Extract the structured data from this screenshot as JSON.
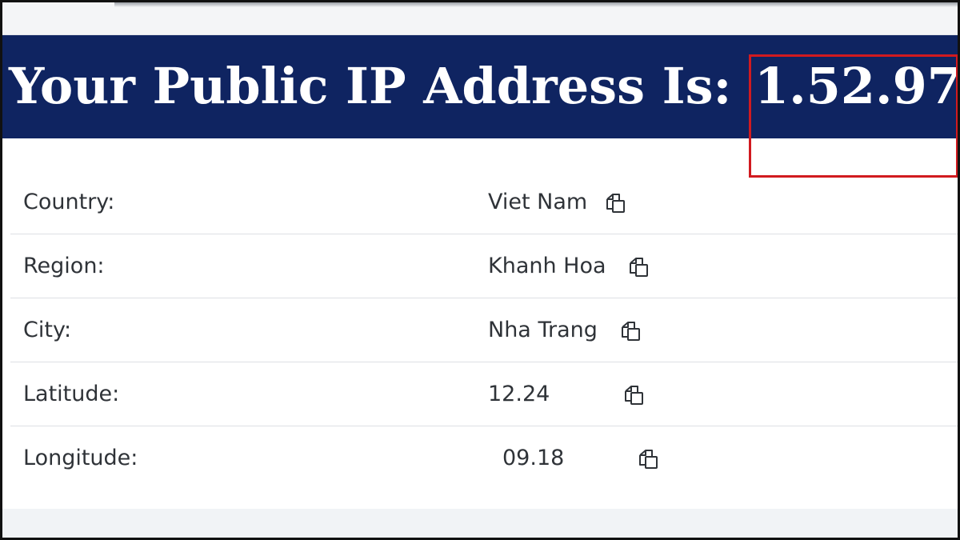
{
  "banner": {
    "title": "Your Public IP Address Is:",
    "ip": "1.52.97"
  },
  "colors": {
    "banner_bg": "#0f2461",
    "highlight": "#d11a1f",
    "text": "#2f3338"
  },
  "rows": [
    {
      "label": "Country:",
      "value": "Viet Nam",
      "icon": "copy-icon"
    },
    {
      "label": "Region:",
      "value": "Khanh Hoa",
      "icon": "copy-icon"
    },
    {
      "label": "City:",
      "value": "Nha Trang",
      "icon": "copy-icon"
    },
    {
      "label": "Latitude:",
      "value": "12.24",
      "icon": "copy-icon"
    },
    {
      "label": "Longitude:",
      "value": "09.18",
      "icon": "copy-icon"
    }
  ]
}
